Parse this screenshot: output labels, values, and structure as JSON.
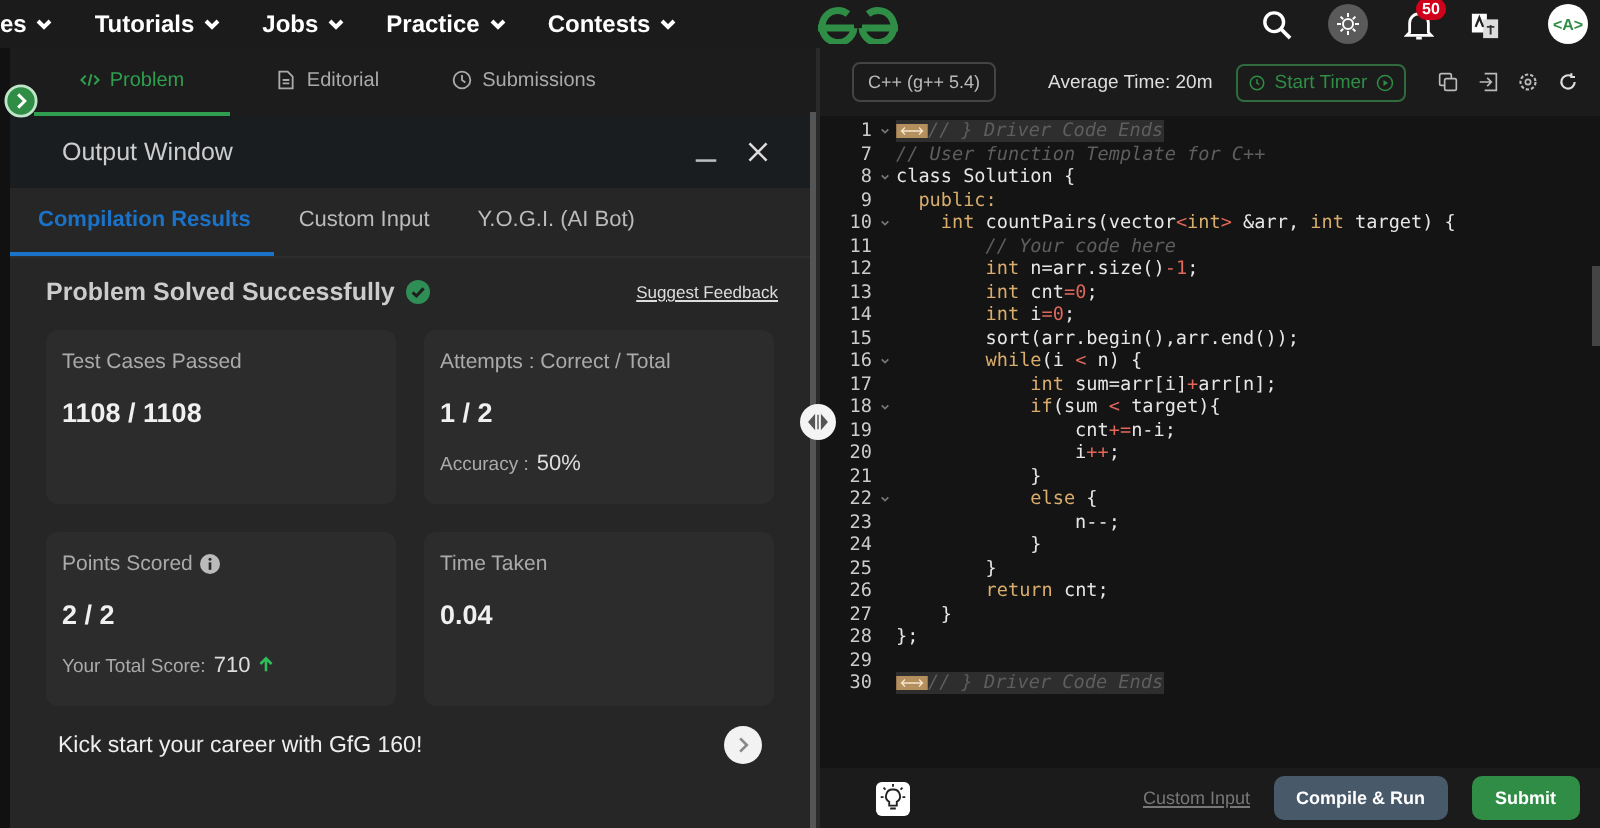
{
  "nav": {
    "items": [
      "es",
      "Tutorials",
      "Jobs",
      "Practice",
      "Contests"
    ],
    "notifications": "50",
    "avatar": "<A>"
  },
  "problem_tabs": [
    {
      "label": "Problem",
      "kind": "code",
      "selected": true
    },
    {
      "label": "Editorial",
      "kind": "doc",
      "selected": false
    },
    {
      "label": "Submissions",
      "kind": "clock",
      "selected": false
    }
  ],
  "output": {
    "title": "Output Window",
    "tabs": [
      {
        "label": "Compilation Results",
        "selected": true
      },
      {
        "label": "Custom Input",
        "selected": false
      },
      {
        "label": "Y.O.G.I. (AI Bot)",
        "selected": false
      }
    ],
    "status": "Problem Solved Successfully",
    "feedback": "Suggest Feedback",
    "cards": [
      {
        "title": "Test Cases Passed",
        "value": "1108 / 1108"
      },
      {
        "title": "Attempts : Correct / Total",
        "value": "1 / 2",
        "note_label": "Accuracy :",
        "note_value": "50%"
      },
      {
        "title": "Points Scored",
        "info": true,
        "value": "2 / 2",
        "note_label": "Your Total Score:",
        "note_value": "710",
        "trend_up": true
      },
      {
        "title": "Time Taken",
        "value": "0.04"
      }
    ],
    "promo": "Kick start your career with GfG 160!"
  },
  "editor": {
    "language": "C++ (g++ 5.4)",
    "average_time": "Average Time: 20m",
    "timer": "Start Timer",
    "lines": [
      {
        "num": "1",
        "fold": true,
        "collapsed": true,
        "tokens": [
          {
            "t": "// } Driver Code Ends",
            "kind": "comment"
          }
        ]
      },
      {
        "num": "7",
        "fold": false,
        "collapsed": false,
        "tokens": [
          {
            "t": "// User function Template for C++",
            "kind": "comment"
          }
        ]
      },
      {
        "num": "8",
        "fold": true,
        "collapsed": false,
        "tokens": [
          {
            "t": "class Solution {",
            "kind": "plain"
          }
        ]
      },
      {
        "num": "9",
        "fold": false,
        "collapsed": false,
        "tokens": [
          {
            "t": "  public:",
            "kind": "kw"
          }
        ]
      },
      {
        "num": "10",
        "fold": true,
        "collapsed": false,
        "tokens": [
          {
            "t": "    int",
            "kind": "kw"
          },
          {
            "t": " countPairs(vector",
            "kind": "plain"
          },
          {
            "t": "<",
            "kind": "op"
          },
          {
            "t": "int",
            "kind": "kw"
          },
          {
            "t": ">",
            "kind": "op"
          },
          {
            "t": " &arr, ",
            "kind": "plain"
          },
          {
            "t": "int",
            "kind": "kw"
          },
          {
            "t": " target) {",
            "kind": "plain"
          }
        ]
      },
      {
        "num": "11",
        "fold": false,
        "collapsed": false,
        "tokens": [
          {
            "t": "        // Your code here",
            "kind": "comment"
          }
        ]
      },
      {
        "num": "12",
        "fold": false,
        "collapsed": false,
        "tokens": [
          {
            "t": "        int",
            "kind": "kw"
          },
          {
            "t": " n=arr.size()",
            "kind": "plain"
          },
          {
            "t": "-",
            "kind": "op"
          },
          {
            "t": "1",
            "kind": "num"
          },
          {
            "t": ";",
            "kind": "plain"
          }
        ]
      },
      {
        "num": "13",
        "fold": false,
        "collapsed": false,
        "tokens": [
          {
            "t": "        int",
            "kind": "kw"
          },
          {
            "t": " cnt",
            "kind": "plain"
          },
          {
            "t": "=",
            "kind": "op"
          },
          {
            "t": "0",
            "kind": "num"
          },
          {
            "t": ";",
            "kind": "plain"
          }
        ]
      },
      {
        "num": "14",
        "fold": false,
        "collapsed": false,
        "tokens": [
          {
            "t": "        int",
            "kind": "kw"
          },
          {
            "t": " i",
            "kind": "plain"
          },
          {
            "t": "=",
            "kind": "op"
          },
          {
            "t": "0",
            "kind": "num"
          },
          {
            "t": ";",
            "kind": "plain"
          }
        ]
      },
      {
        "num": "15",
        "fold": false,
        "collapsed": false,
        "tokens": [
          {
            "t": "        sort(arr.begin(),arr.end());",
            "kind": "plain"
          }
        ]
      },
      {
        "num": "16",
        "fold": true,
        "collapsed": false,
        "tokens": [
          {
            "t": "        while",
            "kind": "kw"
          },
          {
            "t": "(i ",
            "kind": "plain"
          },
          {
            "t": "<",
            "kind": "op"
          },
          {
            "t": " n) {",
            "kind": "plain"
          }
        ]
      },
      {
        "num": "17",
        "fold": false,
        "collapsed": false,
        "tokens": [
          {
            "t": "            int",
            "kind": "kw"
          },
          {
            "t": " sum=arr[i]",
            "kind": "plain"
          },
          {
            "t": "+",
            "kind": "op"
          },
          {
            "t": "arr[n];",
            "kind": "plain"
          }
        ]
      },
      {
        "num": "18",
        "fold": true,
        "collapsed": false,
        "tokens": [
          {
            "t": "            if",
            "kind": "kw"
          },
          {
            "t": "(sum ",
            "kind": "plain"
          },
          {
            "t": "<",
            "kind": "op"
          },
          {
            "t": " target){",
            "kind": "plain"
          }
        ]
      },
      {
        "num": "19",
        "fold": false,
        "collapsed": false,
        "tokens": [
          {
            "t": "                cnt",
            "kind": "plain"
          },
          {
            "t": "+=",
            "kind": "op"
          },
          {
            "t": "n-i;",
            "kind": "plain"
          }
        ]
      },
      {
        "num": "20",
        "fold": false,
        "collapsed": false,
        "tokens": [
          {
            "t": "                i",
            "kind": "plain"
          },
          {
            "t": "++",
            "kind": "op"
          },
          {
            "t": ";",
            "kind": "plain"
          }
        ]
      },
      {
        "num": "21",
        "fold": false,
        "collapsed": false,
        "tokens": [
          {
            "t": "            }",
            "kind": "plain"
          }
        ]
      },
      {
        "num": "22",
        "fold": true,
        "collapsed": false,
        "tokens": [
          {
            "t": "            else",
            "kind": "kw"
          },
          {
            "t": " {",
            "kind": "plain"
          }
        ]
      },
      {
        "num": "23",
        "fold": false,
        "collapsed": false,
        "tokens": [
          {
            "t": "                n--;",
            "kind": "plain"
          }
        ]
      },
      {
        "num": "24",
        "fold": false,
        "collapsed": false,
        "tokens": [
          {
            "t": "            }",
            "kind": "plain"
          }
        ]
      },
      {
        "num": "25",
        "fold": false,
        "collapsed": false,
        "tokens": [
          {
            "t": "        }",
            "kind": "plain"
          }
        ]
      },
      {
        "num": "26",
        "fold": false,
        "collapsed": false,
        "tokens": [
          {
            "t": "        return",
            "kind": "kw"
          },
          {
            "t": " cnt;",
            "kind": "plain"
          }
        ]
      },
      {
        "num": "27",
        "fold": false,
        "collapsed": false,
        "tokens": [
          {
            "t": "    }",
            "kind": "plain"
          }
        ]
      },
      {
        "num": "28",
        "fold": false,
        "collapsed": false,
        "tokens": [
          {
            "t": "};",
            "kind": "plain"
          }
        ]
      },
      {
        "num": "29",
        "fold": false,
        "collapsed": false
      },
      {
        "num": "30",
        "fold": false,
        "collapsed": true,
        "tokens": [
          {
            "t": "// } Driver Code Ends",
            "kind": "comment"
          }
        ]
      }
    ],
    "custom_input": "Custom Input",
    "compile": "Compile & Run",
    "submit": "Submit"
  }
}
